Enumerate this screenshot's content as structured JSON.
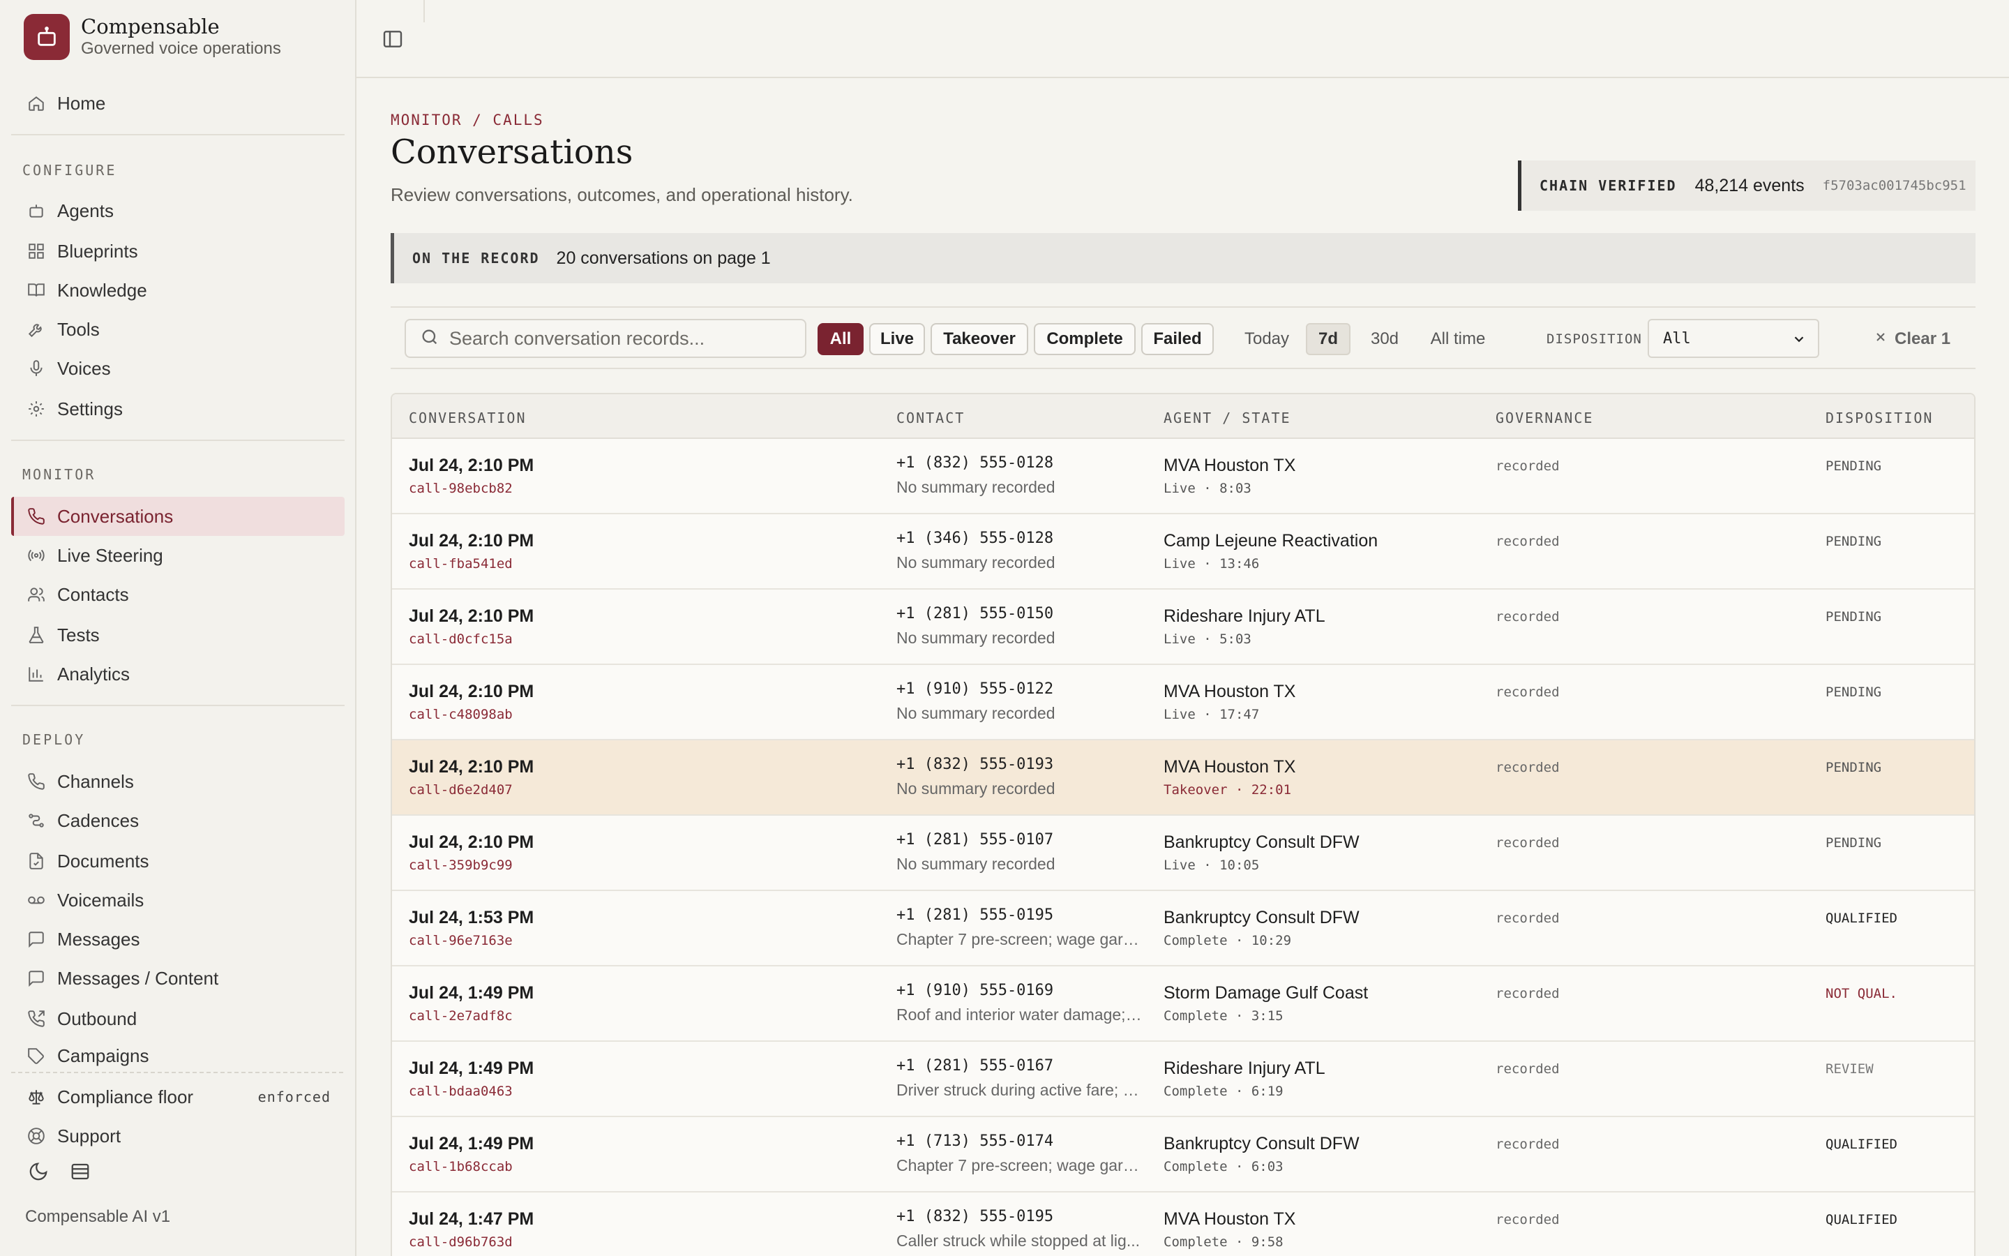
{
  "brand": {
    "name": "Compensable",
    "subtitle": "Governed voice operations"
  },
  "nav": {
    "home": "Home",
    "configure_label": "CONFIGURE",
    "configure": [
      "Agents",
      "Blueprints",
      "Knowledge",
      "Tools",
      "Voices",
      "Settings"
    ],
    "monitor_label": "MONITOR",
    "monitor": [
      "Conversations",
      "Live Steering",
      "Contacts",
      "Tests",
      "Analytics"
    ],
    "deploy_label": "DEPLOY",
    "deploy": [
      "Channels",
      "Cadences",
      "Documents",
      "Voicemails",
      "Messages",
      "Messages / Content",
      "Outbound",
      "Campaigns"
    ],
    "compliance": "Compliance floor",
    "compliance_badge": "enforced",
    "support": "Support",
    "version": "Compensable AI v1"
  },
  "page": {
    "breadcrumb": "MONITOR / CALLS",
    "title": "Conversations",
    "subtitle": "Review conversations, outcomes, and operational history."
  },
  "chain": {
    "label": "CHAIN VERIFIED",
    "events": "48,214 events",
    "hash": "f5703ac001745bc951"
  },
  "record": {
    "label": "ON THE RECORD",
    "text": "20 conversations on page 1"
  },
  "filters": {
    "search_placeholder": "Search conversation records...",
    "status": [
      "All",
      "Live",
      "Takeover",
      "Complete",
      "Failed"
    ],
    "status_active": "All",
    "ranges": [
      "Today",
      "7d",
      "30d",
      "All time"
    ],
    "range_active": "7d",
    "disposition_label": "DISPOSITION",
    "disposition_value": "All",
    "clear": "Clear 1"
  },
  "table": {
    "headers": [
      "CONVERSATION",
      "CONTACT",
      "AGENT / STATE",
      "GOVERNANCE",
      "DISPOSITION"
    ],
    "rows": [
      {
        "time": "Jul 24, 2:10 PM",
        "id": "call-98ebcb82",
        "phone": "+1 (832) 555-0128",
        "summary": "No summary recorded",
        "agent": "MVA Houston TX",
        "state": "Live · 8:03",
        "gov": "recorded",
        "disp": "PENDING"
      },
      {
        "time": "Jul 24, 2:10 PM",
        "id": "call-fba541ed",
        "phone": "+1 (346) 555-0128",
        "summary": "No summary recorded",
        "agent": "Camp Lejeune Reactivation",
        "state": "Live · 13:46",
        "gov": "recorded",
        "disp": "PENDING"
      },
      {
        "time": "Jul 24, 2:10 PM",
        "id": "call-d0cfc15a",
        "phone": "+1 (281) 555-0150",
        "summary": "No summary recorded",
        "agent": "Rideshare Injury ATL",
        "state": "Live · 5:03",
        "gov": "recorded",
        "disp": "PENDING"
      },
      {
        "time": "Jul 24, 2:10 PM",
        "id": "call-c48098ab",
        "phone": "+1 (910) 555-0122",
        "summary": "No summary recorded",
        "agent": "MVA Houston TX",
        "state": "Live · 17:47",
        "gov": "recorded",
        "disp": "PENDING"
      },
      {
        "time": "Jul 24, 2:10 PM",
        "id": "call-d6e2d407",
        "phone": "+1 (832) 555-0193",
        "summary": "No summary recorded",
        "agent": "MVA Houston TX",
        "state": "Takeover · 22:01",
        "gov": "recorded",
        "disp": "PENDING"
      },
      {
        "time": "Jul 24, 2:10 PM",
        "id": "call-359b9c99",
        "phone": "+1 (281) 555-0107",
        "summary": "No summary recorded",
        "agent": "Bankruptcy Consult DFW",
        "state": "Live · 10:05",
        "gov": "recorded",
        "disp": "PENDING"
      },
      {
        "time": "Jul 24, 1:53 PM",
        "id": "call-96e7163e",
        "phone": "+1 (281) 555-0195",
        "summary": "Chapter 7 pre-screen; wage garn...",
        "agent": "Bankruptcy Consult DFW",
        "state": "Complete · 10:29",
        "gov": "recorded",
        "disp": "QUALIFIED"
      },
      {
        "time": "Jul 24, 1:49 PM",
        "id": "call-2e7adf8c",
        "phone": "+1 (910) 555-0169",
        "summary": "Roof and interior water damage; ...",
        "agent": "Storm Damage Gulf Coast",
        "state": "Complete · 3:15",
        "gov": "recorded",
        "disp": "NOT QUAL."
      },
      {
        "time": "Jul 24, 1:49 PM",
        "id": "call-bdaa0463",
        "phone": "+1 (281) 555-0167",
        "summary": "Driver struck during active fare; c...",
        "agent": "Rideshare Injury ATL",
        "state": "Complete · 6:19",
        "gov": "recorded",
        "disp": "REVIEW"
      },
      {
        "time": "Jul 24, 1:49 PM",
        "id": "call-1b68ccab",
        "phone": "+1 (713) 555-0174",
        "summary": "Chapter 7 pre-screen; wage garn...",
        "agent": "Bankruptcy Consult DFW",
        "state": "Complete · 6:03",
        "gov": "recorded",
        "disp": "QUALIFIED"
      },
      {
        "time": "Jul 24, 1:47 PM",
        "id": "call-d96b763d",
        "phone": "+1 (832) 555-0195",
        "summary": "Caller struck while stopped at lig...",
        "agent": "MVA Houston TX",
        "state": "Complete · 9:58",
        "gov": "recorded",
        "disp": "QUALIFIED"
      }
    ]
  },
  "colors": {
    "accent": "#8a2a36",
    "highlight_row": "#f5e9d8",
    "active_nav": "#f0dede"
  }
}
